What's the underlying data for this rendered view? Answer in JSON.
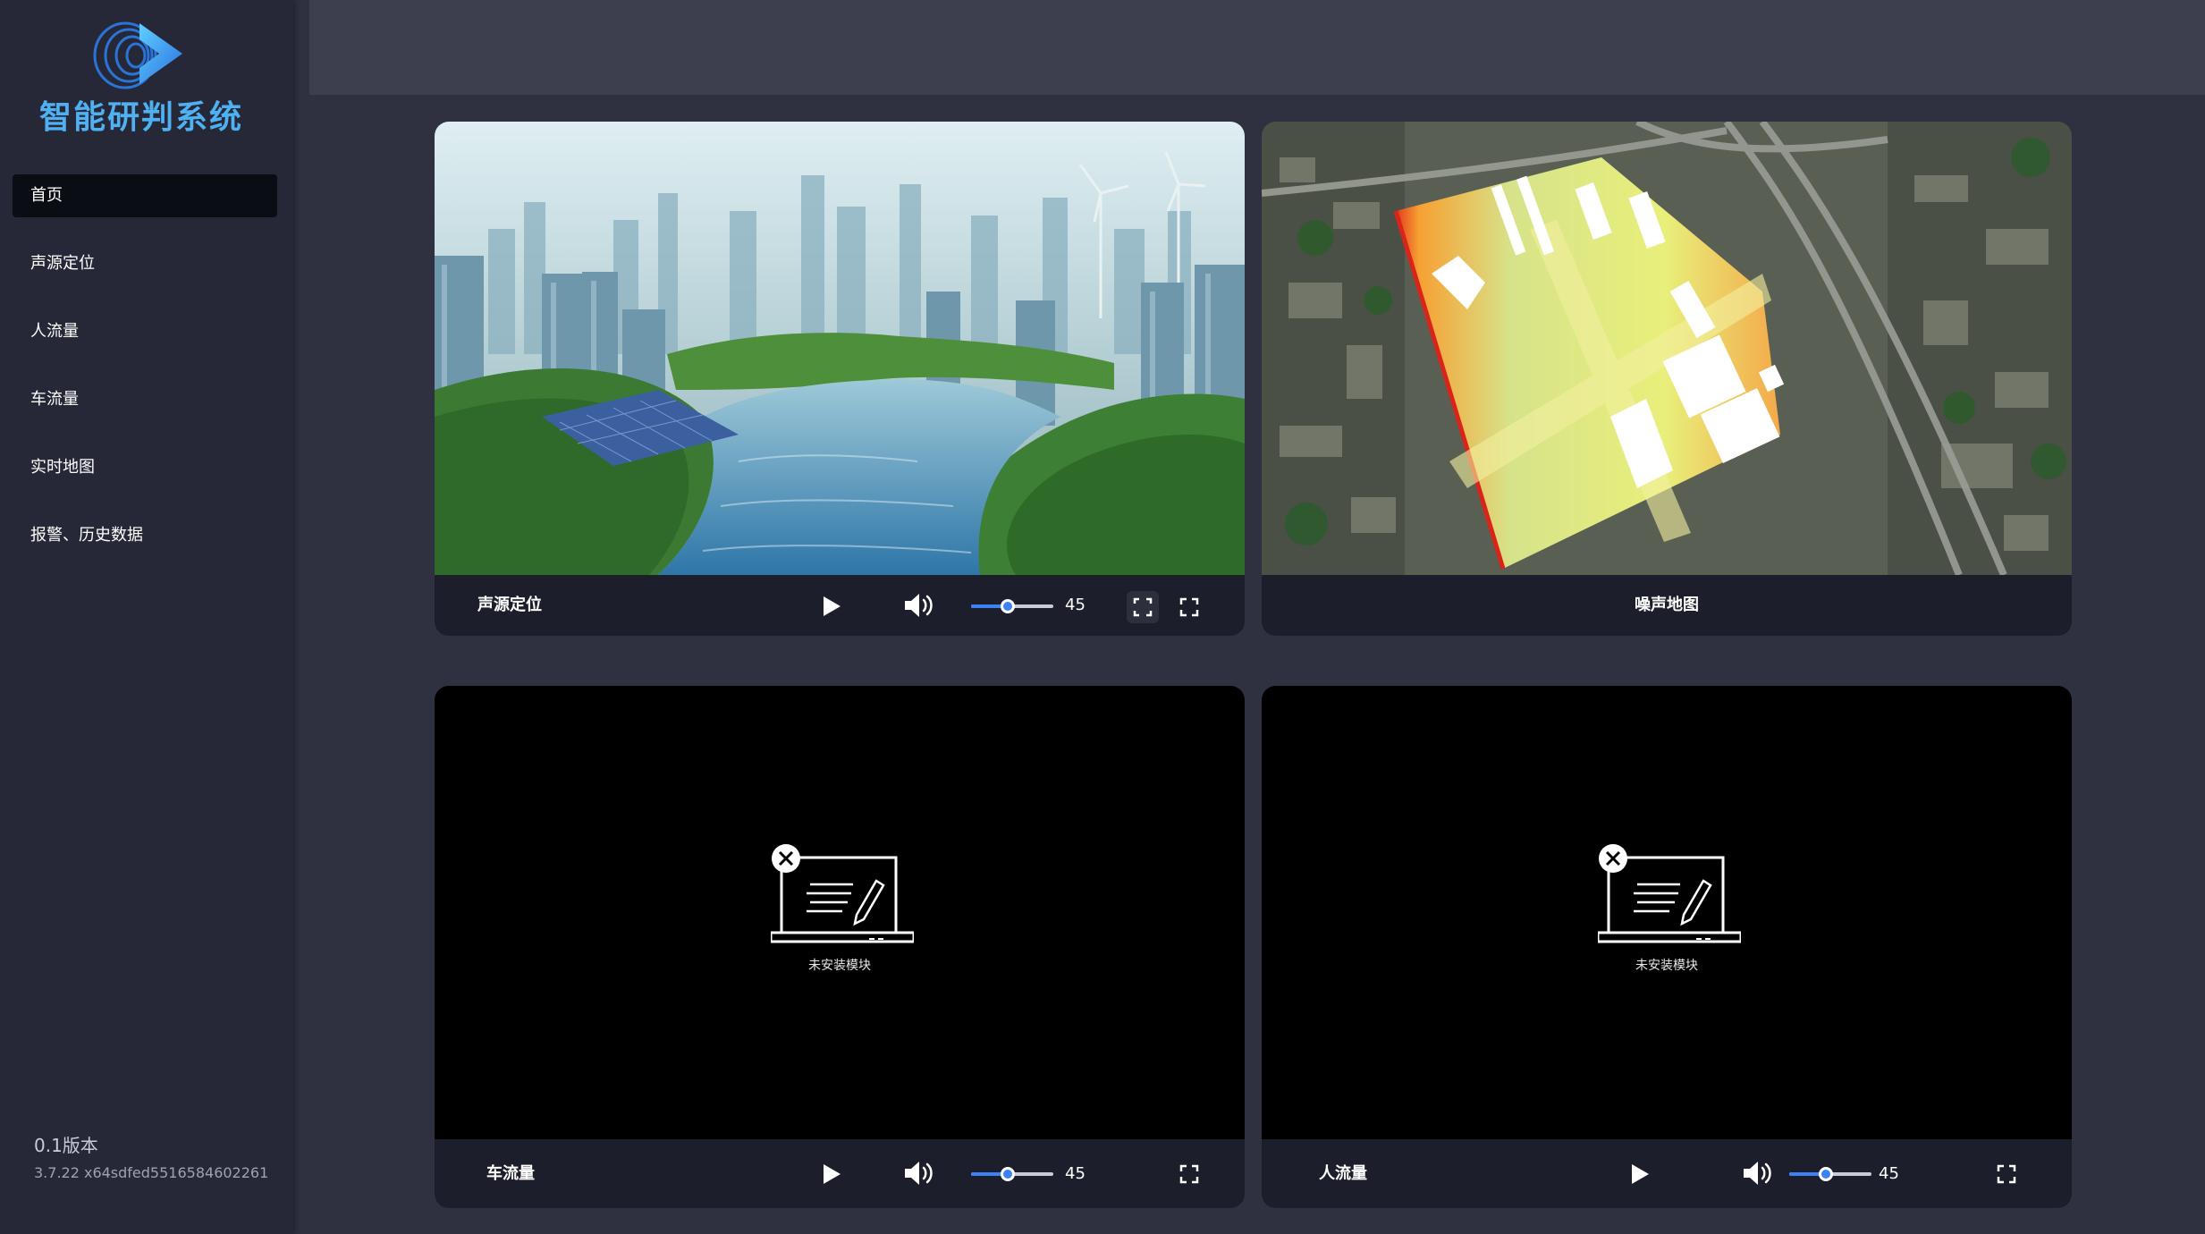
{
  "app": {
    "title": "智能研判系统",
    "version": "0.1版本",
    "build": "3.7.22 x64sdfed5516584602261"
  },
  "nav": {
    "items": [
      {
        "label": "首页",
        "active": true
      },
      {
        "label": "声源定位"
      },
      {
        "label": "人流量"
      },
      {
        "label": "车流量"
      },
      {
        "label": "实时地图"
      },
      {
        "label": "报警、历史数据"
      }
    ]
  },
  "panels": {
    "sound": {
      "label": "声源定位",
      "volume": "45",
      "volume_fraction": 0.45
    },
    "noise_map": {
      "label": "噪声地图"
    },
    "vehicle": {
      "label": "车流量",
      "volume": "45",
      "volume_fraction": 0.45,
      "placeholder": "未安装模块"
    },
    "people": {
      "label": "人流量",
      "volume": "45",
      "volume_fraction": 0.45,
      "placeholder": "未安装模块"
    }
  },
  "colors": {
    "accent": "#3b82f6",
    "title_blue": "#4fb0f2",
    "sidebar": "#262837",
    "background": "#2f3140"
  },
  "icons": [
    "logo-icon",
    "play-icon",
    "volume-icon",
    "fullscreen-icon",
    "not-installed-icon"
  ]
}
